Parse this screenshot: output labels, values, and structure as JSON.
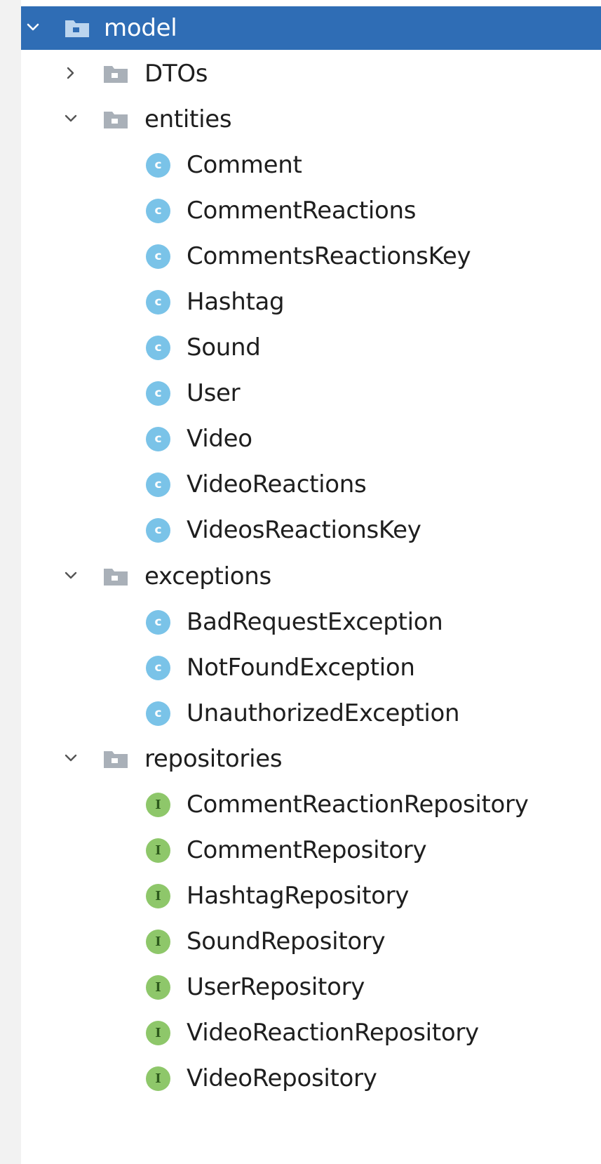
{
  "tree": {
    "root": {
      "label": "model",
      "icon": "folder-icon",
      "expanded": true,
      "selected": true
    },
    "dtos": {
      "label": "DTOs",
      "icon": "folder-icon",
      "expanded": false
    },
    "entities": {
      "label": "entities",
      "icon": "folder-icon",
      "expanded": true,
      "items": [
        {
          "label": "Comment",
          "kind": "class",
          "badge": "c"
        },
        {
          "label": "CommentReactions",
          "kind": "class",
          "badge": "c"
        },
        {
          "label": "CommentsReactionsKey",
          "kind": "class",
          "badge": "c"
        },
        {
          "label": "Hashtag",
          "kind": "class",
          "badge": "c"
        },
        {
          "label": "Sound",
          "kind": "class",
          "badge": "c"
        },
        {
          "label": "User",
          "kind": "class",
          "badge": "c"
        },
        {
          "label": "Video",
          "kind": "class",
          "badge": "c"
        },
        {
          "label": "VideoReactions",
          "kind": "class",
          "badge": "c"
        },
        {
          "label": "VideosReactionsKey",
          "kind": "class",
          "badge": "c"
        }
      ]
    },
    "exceptions": {
      "label": "exceptions",
      "icon": "folder-icon",
      "expanded": true,
      "items": [
        {
          "label": "BadRequestException",
          "kind": "class",
          "badge": "c"
        },
        {
          "label": "NotFoundException",
          "kind": "class",
          "badge": "c"
        },
        {
          "label": "UnauthorizedException",
          "kind": "class",
          "badge": "c"
        }
      ]
    },
    "repositories": {
      "label": "repositories",
      "icon": "folder-icon",
      "expanded": true,
      "items": [
        {
          "label": "CommentReactionRepository",
          "kind": "interface",
          "badge": "I"
        },
        {
          "label": "CommentRepository",
          "kind": "interface",
          "badge": "I"
        },
        {
          "label": "HashtagRepository",
          "kind": "interface",
          "badge": "I"
        },
        {
          "label": "SoundRepository",
          "kind": "interface",
          "badge": "I"
        },
        {
          "label": "UserRepository",
          "kind": "interface",
          "badge": "I"
        },
        {
          "label": "VideoReactionRepository",
          "kind": "interface",
          "badge": "I"
        },
        {
          "label": "VideoRepository",
          "kind": "interface",
          "badge": "I"
        }
      ]
    }
  },
  "colors": {
    "selection": "#2f6db5",
    "class_badge": "#7ac3e8",
    "interface_badge": "#8ec76a",
    "folder": "#a9b0b8"
  }
}
